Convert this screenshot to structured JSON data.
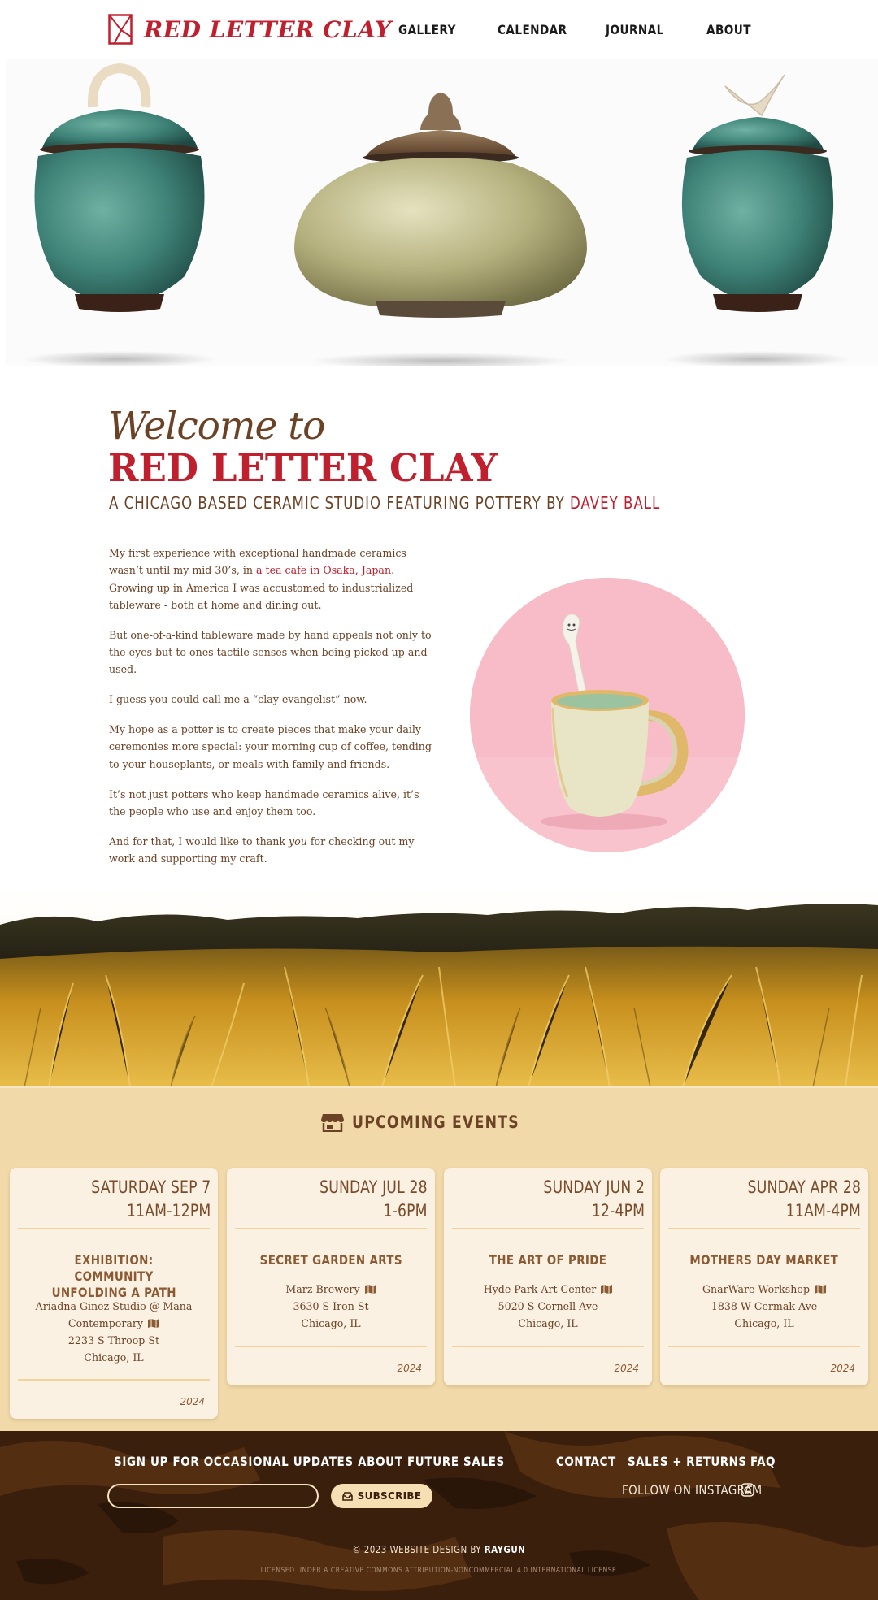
{
  "header": {
    "logo_text": "RED LETTER CLAY",
    "nav": [
      {
        "label": "GALLERY"
      },
      {
        "label": "CALENDAR"
      },
      {
        "label": "JOURNAL"
      },
      {
        "label": "ABOUT"
      }
    ]
  },
  "welcome": {
    "subtitle": "Welcome to",
    "title": "RED LETTER CLAY",
    "tagline_prefix": "A CHICAGO BASED CERAMIC STUDIO FEATURING POTTERY BY ",
    "tagline_name": "DAVEY BALL"
  },
  "story": {
    "p1_before": "My first experience with exceptional handmade ceramics wasn’t until my mid 30’s, in ",
    "p1_link": "a tea cafe in Osaka, Japan",
    "p1_after": ". Growing up in America I was accustomed to industrialized tableware - both at home and dining out.",
    "p2": "But one-of-a-kind tableware made by hand appeals not only to the eyes but to ones tactile senses when being picked up and used.",
    "p3": "I guess you could call me a “clay evangelist” now.",
    "p4": "My hope as a potter is to create pieces that make your daily ceremonies more special: your morning cup of coffee, tending to your houseplants, or meals with family and friends.",
    "p5": "It’s not just potters who keep handmade ceramics alive, it’s the people who use and enjoy them too.",
    "p6_before": "And for that, I would like to thank ",
    "p6_em": "you",
    "p6_after": " for checking out my work and supporting my craft."
  },
  "events": {
    "heading": "UPCOMING EVENTS",
    "items": [
      {
        "day": "SATURDAY SEP 7",
        "time": "11AM-12PM",
        "title_1": "EXHIBITION: COMMUNITY",
        "title_2": "UNFOLDING A PATH",
        "venue_1": "Ariadna Ginez Studio @ Mana",
        "venue_2": "Contemporary",
        "address": "2233 S Throop St",
        "city": "Chicago, IL",
        "year": "2024"
      },
      {
        "day": "SUNDAY JUL 28",
        "time": "1-6PM",
        "title_1": "SECRET GARDEN ARTS",
        "venue_1": "Marz Brewery",
        "address": "3630 S Iron St",
        "city": "Chicago, IL",
        "year": "2024"
      },
      {
        "day": "SUNDAY JUN 2",
        "time": "12-4PM",
        "title_1": "THE ART OF PRIDE",
        "venue_1": "Hyde Park Art Center",
        "address": "5020 S Cornell Ave",
        "city": "Chicago, IL",
        "year": "2024"
      },
      {
        "day": "SUNDAY APR 28",
        "time": "11AM-4PM",
        "title_1": "MOTHERS DAY MARKET",
        "venue_1": "GnarWare Workshop",
        "address": "1838 W Cermak Ave",
        "city": "Chicago, IL",
        "year": "2024"
      }
    ]
  },
  "footer": {
    "signup_label": "SIGN UP FOR OCCASIONAL UPDATES ABOUT FUTURE SALES",
    "email_value": "",
    "subscribe_label": "SUBSCRIBE",
    "links": [
      {
        "label": "CONTACT"
      },
      {
        "label": "SALES + RETURNS"
      },
      {
        "label": "FAQ"
      }
    ],
    "instagram_label": "FOLLOW ON INSTAGRAM",
    "copyright_prefix": "© 2023 WEBSITE DESIGN BY ",
    "copyright_name": "RAYGUN",
    "license": "LICENSED UNDER A CREATIVE COMMONS ATTRIBUTION-NONCOMMERCIAL 4.0 INTERNATIONAL LICENSE"
  },
  "colors": {
    "brand_red": "#c0202e",
    "text_brown": "#6b4226",
    "events_bg": "#f1d9a9",
    "card_bg": "#fbf1e2",
    "footer_bg": "#3a1e0c"
  },
  "icons": [
    "logo-mark-icon",
    "storefront-icon",
    "map-icon",
    "inbox-icon",
    "instagram-icon"
  ]
}
